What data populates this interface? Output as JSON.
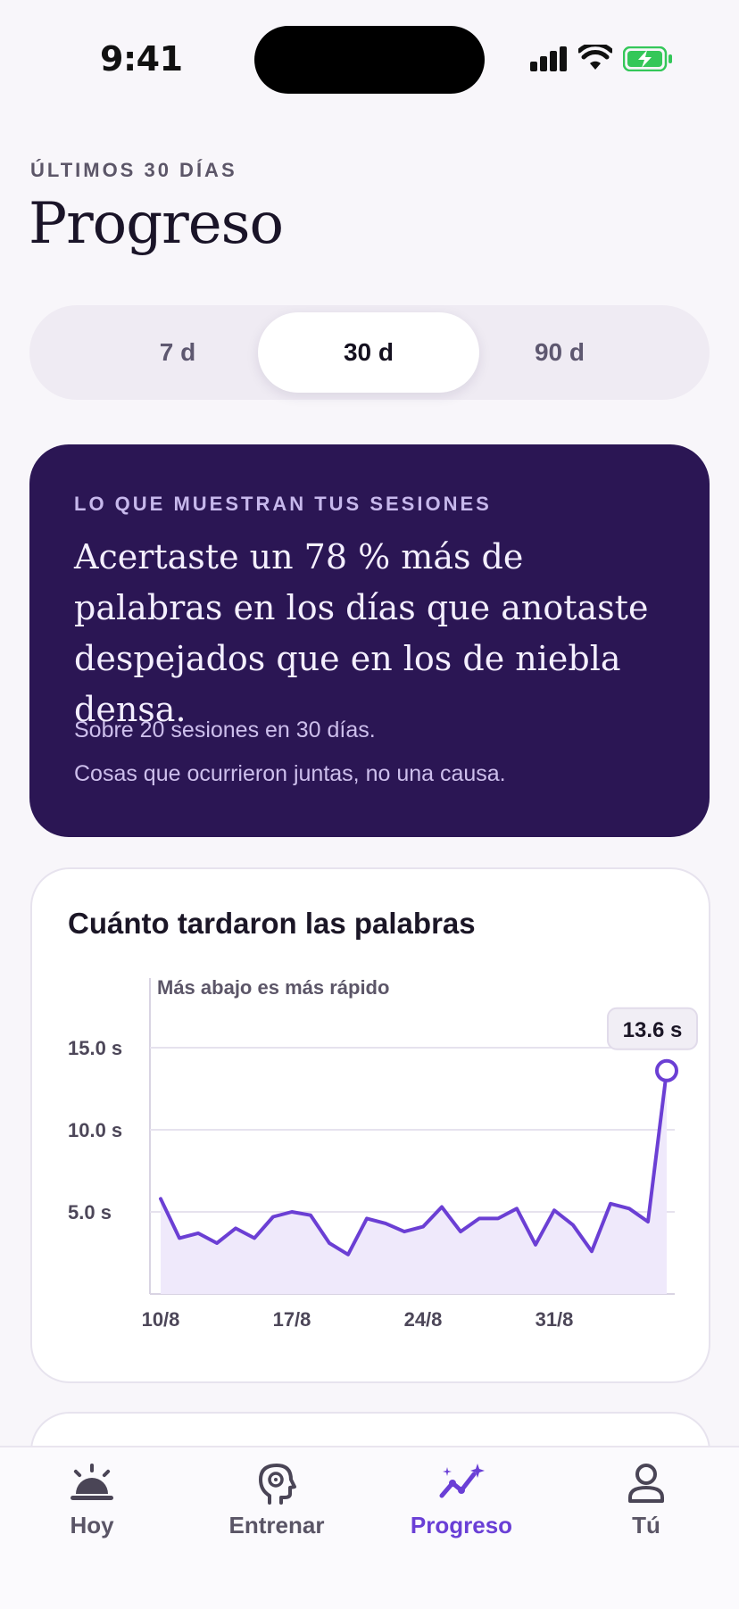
{
  "status_bar": {
    "time": "9:41"
  },
  "header": {
    "eyebrow": "ÚLTIMOS 30 DÍAS",
    "title": "Progreso"
  },
  "range_selector": {
    "options": [
      {
        "label": "7 d",
        "selected": false
      },
      {
        "label": "30 d",
        "selected": true
      },
      {
        "label": "90 d",
        "selected": false
      }
    ]
  },
  "insight_card": {
    "label": "LO QUE MUESTRAN TUS SESIONES",
    "headline": "Acertaste un 78 % más de palabras en los días que anotaste despejados que en los de niebla densa.",
    "note_1": "Sobre 20 sesiones en 30 días.",
    "note_2": "Cosas que ocurrieron juntas, no una causa."
  },
  "response_time_card": {
    "title": "Cuánto tardaron las palabras"
  },
  "chart_data": {
    "type": "area",
    "title": "Cuánto tardaron las palabras",
    "annotation": "Más abajo es más rápido",
    "y_tick_labels": [
      "15.0 s",
      "10.0 s",
      "5.0 s"
    ],
    "x_tick_labels": [
      "10/8",
      "17/8",
      "24/8",
      "31/8"
    ],
    "ylim": [
      0,
      15.0
    ],
    "grid": true,
    "accent_color": "#6b3fd4",
    "callout": "13.6 s",
    "x": [
      "10/8",
      "11/8",
      "12/8",
      "13/8",
      "14/8",
      "15/8",
      "16/8",
      "17/8",
      "18/8",
      "19/8",
      "20/8",
      "21/8",
      "22/8",
      "23/8",
      "24/8",
      "25/8",
      "26/8",
      "27/8",
      "28/8",
      "29/8",
      "30/8",
      "31/8",
      "1/9",
      "2/9",
      "3/9",
      "4/9",
      "5/9",
      "6/9",
      "7/9",
      "8/9"
    ],
    "series": [
      {
        "values": [
          5.8,
          3.4,
          3.7,
          3.1,
          4.0,
          3.4,
          4.7,
          5.0,
          4.8,
          3.1,
          2.4,
          4.6,
          4.3,
          3.8,
          4.1,
          5.3,
          3.8,
          4.6,
          4.6,
          5.2,
          3.0,
          5.1,
          4.2,
          2.6,
          5.5,
          5.2,
          4.4,
          13.6
        ]
      }
    ]
  },
  "tab_bar": {
    "tabs": [
      {
        "label": "Hoy",
        "icon": "sunrise-icon",
        "active": false
      },
      {
        "label": "Entrenar",
        "icon": "brain-head-icon",
        "active": false
      },
      {
        "label": "Progreso",
        "icon": "trend-sparkle-icon",
        "active": true
      },
      {
        "label": "Tú",
        "icon": "person-icon",
        "active": false
      }
    ]
  }
}
